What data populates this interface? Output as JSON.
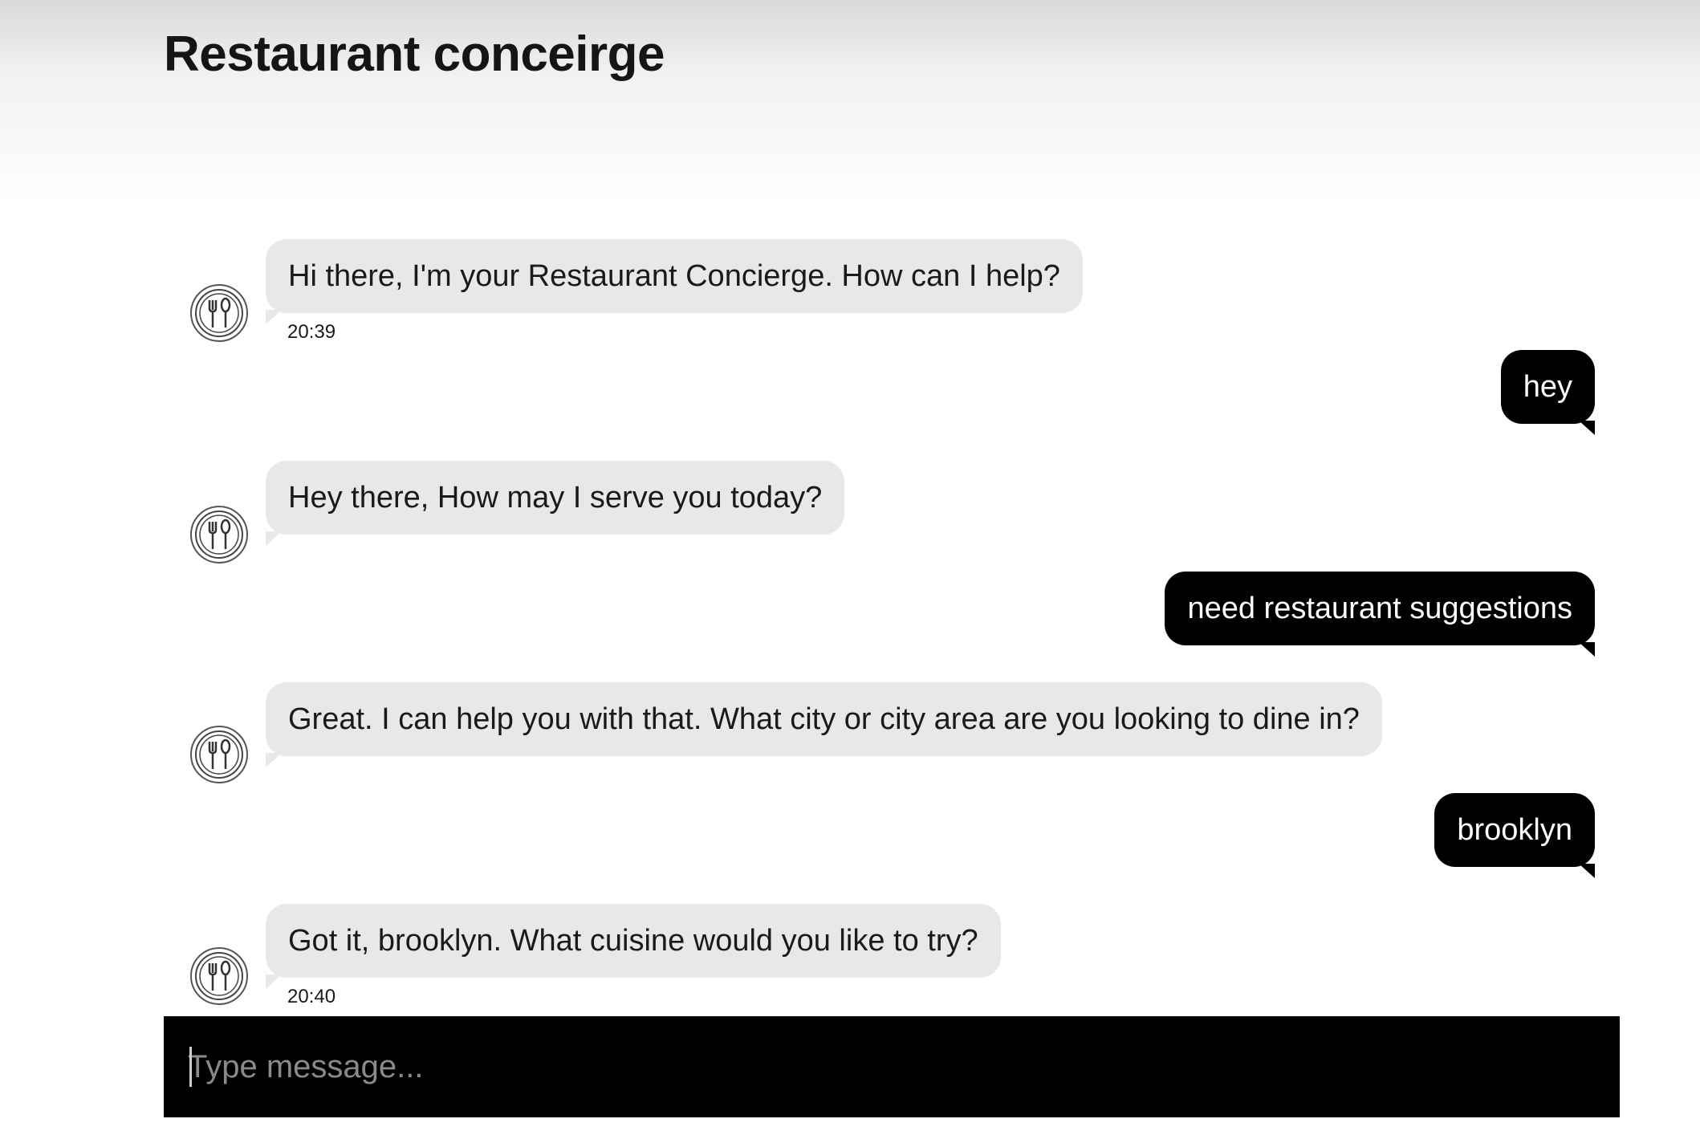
{
  "app": {
    "title": "Restaurant conceirge"
  },
  "messages": [
    {
      "sender": "bot",
      "text": "Hi there, I'm your Restaurant Concierge. How can I help?",
      "time": "20:39"
    },
    {
      "sender": "user",
      "text": "hey"
    },
    {
      "sender": "bot",
      "text": "Hey there, How may I serve you today?"
    },
    {
      "sender": "user",
      "text": "need restaurant suggestions"
    },
    {
      "sender": "bot",
      "text": "Great. I can help you with that. What city or city area are you looking to dine in?"
    },
    {
      "sender": "user",
      "text": "brooklyn"
    },
    {
      "sender": "bot",
      "text": "Got it, brooklyn. What cuisine would you like to try?",
      "time": "20:40"
    }
  ],
  "composer": {
    "placeholder": "Type message..."
  },
  "icons": {
    "bot_avatar": "restaurant-fork-knife-icon"
  },
  "colors": {
    "bot_bubble": "#e8e8e8",
    "user_bubble": "#000000",
    "composer": "#000000"
  }
}
